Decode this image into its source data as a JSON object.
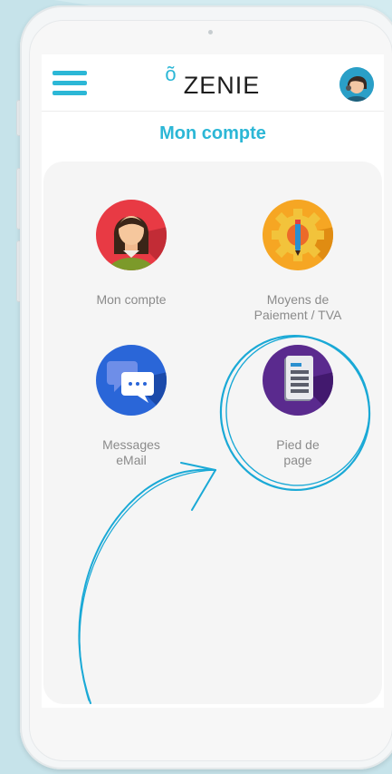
{
  "app": {
    "brand": "ZENIE",
    "brand_mark": "õ",
    "page_title": "Mon compte"
  },
  "header": {
    "menu_icon": "hamburger-menu-icon",
    "profile_icon": "user-avatar-icon"
  },
  "tiles": [
    {
      "label": "Mon compte",
      "icon": "woman-avatar-icon"
    },
    {
      "label": "Moyens de\nPaiement / TVA",
      "icon": "gear-pencil-icon"
    },
    {
      "label": "Messages\neMail",
      "icon": "chat-bubbles-icon"
    },
    {
      "label": "Pied de\npage",
      "icon": "document-icon"
    }
  ],
  "colors": {
    "accent": "#2cb7d6",
    "background": "#c6e3ea",
    "label_text": "#8b8b8b"
  }
}
